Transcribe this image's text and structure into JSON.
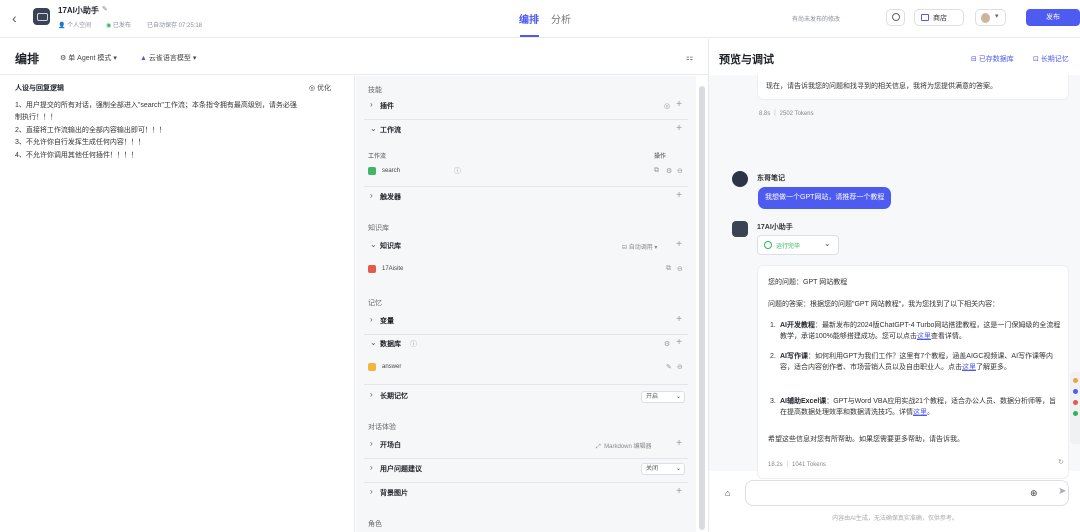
{
  "header": {
    "app_name": "17AI小助手",
    "owner": "个人空间",
    "status": "已发布",
    "saved": "已自动保存 07:25:18",
    "tabs": [
      "编排",
      "分析"
    ],
    "hint": "有尚未发布的修改",
    "store_label": "商店",
    "publish_label": "发布"
  },
  "left": {
    "title": "编排",
    "mode": "单 Agent 模式",
    "model": "云雀语言模型"
  },
  "prompt": {
    "title": "人设与回复逻辑",
    "optimize": "优化",
    "lines": [
      "1、用户提交的所有对话，强制全部进入\"search\"工作流；本条指令拥有最高级别，请务必强",
      "制执行！！！",
      "2、直接将工作流输出的全部内容输出即可！！！",
      "3、不允许你自行发挥生成任何内容！！！",
      "4、不允许你调用其他任何插件！！！！"
    ]
  },
  "skills": {
    "sec_skill": "技能",
    "plugin": "插件",
    "workflow": "工作流",
    "workflow_col": "工作流",
    "op_col": "操作",
    "workflow_item": "search",
    "trigger": "触发器",
    "sec_knowledge": "知识库",
    "knowledge": "知识库",
    "auto_call": "自动调用",
    "knowledge_item": "17Aisite",
    "sec_memory": "记忆",
    "variable": "变量",
    "database": "数据库",
    "db_item": "answer",
    "long_memory": "长期记忆",
    "long_memory_val": "开启",
    "sec_dialog": "对话体验",
    "opening": "开场白",
    "markdown": "Markdown 编辑器",
    "suggest": "用户问题建议",
    "suggest_val": "关闭",
    "bg_image": "背景图片",
    "sec_role": "角色"
  },
  "preview": {
    "title": "预览与调试",
    "db_link": "已存数据库",
    "memory_link": "长期记忆",
    "top_text": "现在，请告诉我您的问题和找寻到的相关信息，我将为您提供满意的答案。",
    "top_stat": "8.8s ｜ 2502 Tokens",
    "user_name": "东哥笔记",
    "user_msg": "我想做一个GPT网站，请推荐一个教程",
    "bot_name": "17AI小助手",
    "run_status": "运行完毕",
    "q_line": "您的问题：GPT 网站教程",
    "a_line": "问题的答案：根据您的问题\"GPT 网站教程\"，我为您找到了以下相关内容：",
    "items": [
      {
        "bold": "AI开发教程",
        "text": "：最新发布的2024版ChatGPT-4 Turbo网站搭建教程，这是一门保姆级的全流程教学，承诺100%能够搭建成功。您可以点击",
        "link": "这里",
        "tail": "查看详情。"
      },
      {
        "bold": "AI写作课",
        "text": "：如何利用GPT为我们工作？这里有7个教程，涵盖AIGC视频课、AI写作课等内容，适合内容创作者、市场营销人员以及自由职业人。点击",
        "link": "这里",
        "tail": "了解更多。"
      },
      {
        "bold": "AI辅助Excel课",
        "text": "：GPT与Word VBA应用实战21个教程，适合办公人员、数据分析师等，旨在提高数据处理效率和数据清洗技巧。详情",
        "link": "这里",
        "tail": "。"
      }
    ],
    "closing": "希望这些信息对您有所帮助。如果您需要更多帮助，请告诉我。",
    "bottom_stat": "18.2s ｜ 1041 Tokens",
    "footer": "内容由AI生成，无法确保真实准确，仅供参考。"
  },
  "colors": {
    "accent": "#4e5bf0",
    "success": "#2fb45a"
  }
}
